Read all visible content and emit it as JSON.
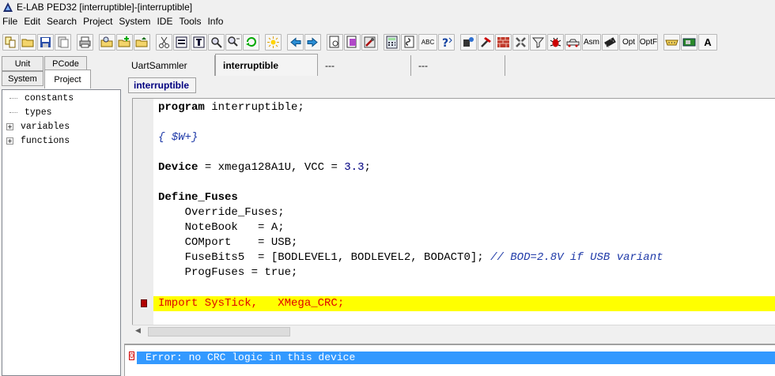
{
  "window": {
    "title": "E-LAB PED32 [interruptible]-[interruptible]"
  },
  "menu": [
    "File",
    "Edit",
    "Search",
    "Project",
    "System",
    "IDE",
    "Tools",
    "Info"
  ],
  "toolbar": {
    "text_buttons": {
      "abc": "ABC",
      "asm": "Asm",
      "opt": "Opt",
      "optf": "OptF",
      "a": "A"
    }
  },
  "left_tabs": {
    "unit": "Unit",
    "pcode": "PCode",
    "system": "System",
    "project": "Project"
  },
  "tree": [
    {
      "label": "constants",
      "expandable": false
    },
    {
      "label": "types",
      "expandable": false
    },
    {
      "label": "variables",
      "expandable": true
    },
    {
      "label": "functions",
      "expandable": true
    }
  ],
  "tree_expand_glyph": "+",
  "editor_tabs": [
    "UartSammler",
    "interruptible",
    "---",
    "---"
  ],
  "active_tab": "interruptible",
  "sub_tab": "interruptible",
  "code": {
    "line1_kw": "program",
    "line1_rest": " interruptible;",
    "line2": "{ $W+}",
    "line3_kw": "Device",
    "line3_rest": " = xmega128A1U, VCC = ",
    "line3_num": "3.3",
    "line3_end": ";",
    "line4": "Define_Fuses",
    "line5": "    Override_Fuses;",
    "line6": "    NoteBook   = A;",
    "line7": "    COMport    = USB;",
    "line8_code": "    FuseBits5  = [BODLEVEL1, BODLEVEL2, BODACT0]; ",
    "line8_comment": "// BOD=2.8V if USB variant",
    "line9": "    ProgFuses = true;",
    "line10": "Import SysTick,   XMega_CRC;"
  },
  "messages": {
    "error_text": "Error: no CRC logic in this device",
    "error_icon_label": "0"
  },
  "colors": {
    "error_highlight": "#ffff00",
    "error_text": "#e00000",
    "comment": "#1f3aa8",
    "message_selection": "#3399ff"
  }
}
